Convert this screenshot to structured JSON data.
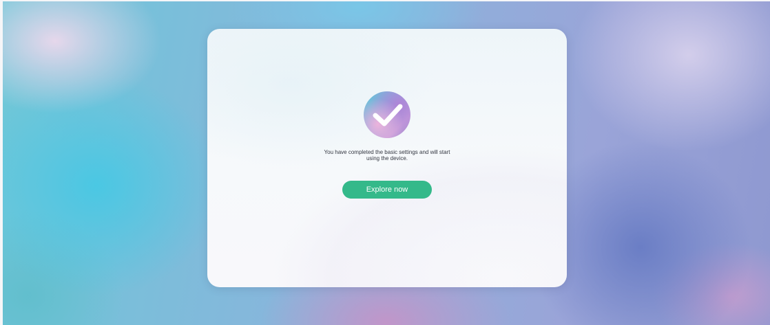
{
  "setup_complete": {
    "icon": "check-circle-icon",
    "message": "You have completed the basic settings and will start using the device.",
    "button_label": "Explore now"
  },
  "colors": {
    "button": "#34b98a",
    "button_text": "#ffffff",
    "message_text": "#333640"
  }
}
